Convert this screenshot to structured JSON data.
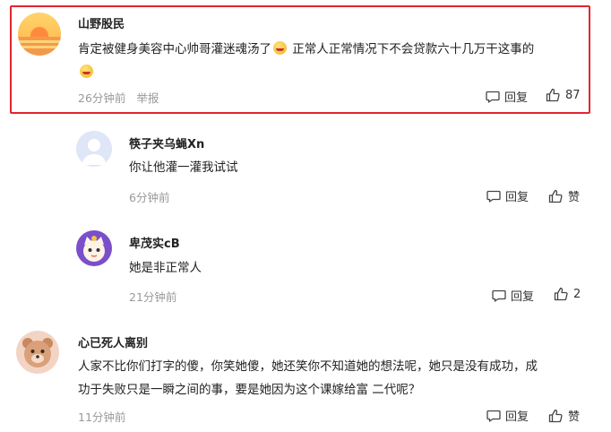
{
  "comments": [
    {
      "username": "山野股民",
      "text_part1": "肯定被健身美容中心帅哥灌迷魂汤了",
      "text_part2": "正常人正常情况下不会贷款六十几万干这事的",
      "time": "26分钟前",
      "report": "举报",
      "reply": "回复",
      "likes": "87",
      "highlighted": true
    },
    {
      "username": "筷子夹乌蝇Xn",
      "text": "你让他灌一灌我试试",
      "time": "6分钟前",
      "reply": "回复",
      "likes": "赞"
    },
    {
      "username": "卑茂实cB",
      "text": "她是非正常人",
      "time": "21分钟前",
      "reply": "回复",
      "likes": "2"
    },
    {
      "username": "心已死人离别",
      "text_line1": "人家不比你们打字的傻，你笑她傻，她还笑你不知道她的想法呢，她只是没有成功，成",
      "text_line2": "功于失败只是一瞬之间的事，要是她因为这个课嫁给富 二代呢？",
      "time": "11分钟前",
      "reply": "回复",
      "likes": "赞"
    }
  ],
  "icons": {
    "reply": "comment-bubble-icon",
    "like": "thumbs-up-icon",
    "emoji": "laughing-emoji-icon"
  },
  "colors": {
    "highlight_border": "#e0262f",
    "meta_text": "#999999"
  }
}
